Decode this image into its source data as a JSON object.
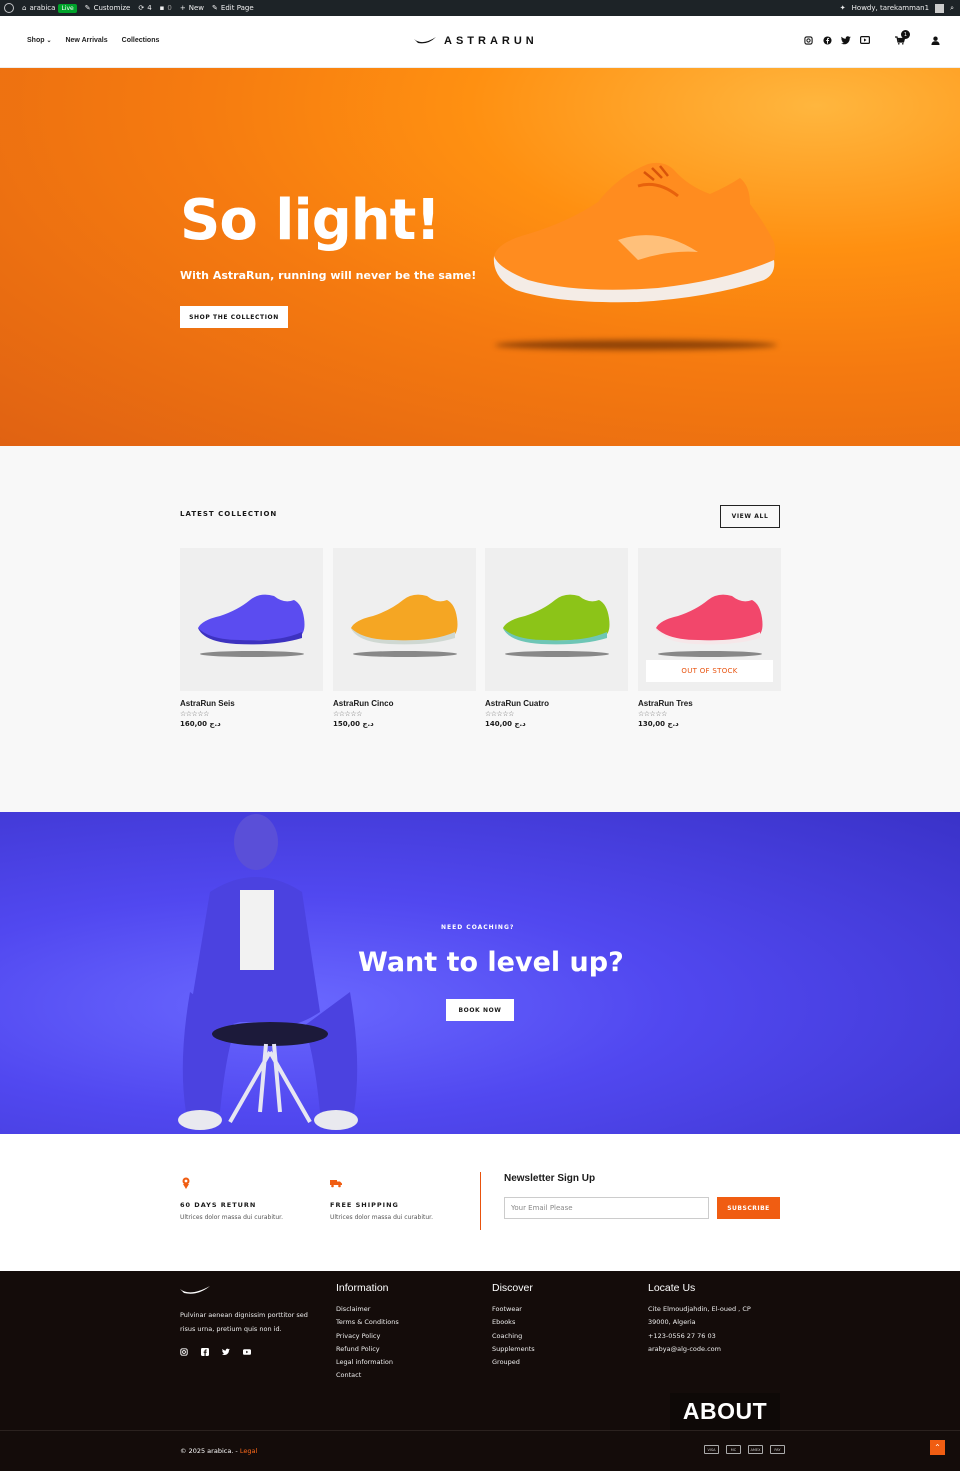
{
  "admin_bar": {
    "site_name": "arabica",
    "live_badge": "Live",
    "customize": "Customize",
    "updates_count": "4",
    "comments_count": "0",
    "new_label": "New",
    "edit_page": "Edit Page",
    "howdy": "Howdy, tarekamman1"
  },
  "header": {
    "nav": [
      "Shop",
      "New Arrivals",
      "Collections"
    ],
    "shop_caret": "⌄",
    "logo_text": "ASTRARUN",
    "cart_count": "1"
  },
  "hero": {
    "title": "So light!",
    "subtitle": "With AstraRun, running will never be the same!",
    "button": "SHOP THE COLLECTION",
    "shoe_color": "#ff8a1f"
  },
  "latest": {
    "title": "LATEST COLLECTION",
    "view_all": "VIEW ALL",
    "products": [
      {
        "name": "AstraRun Seis",
        "stars": "☆☆☆☆☆",
        "price": "160,00 د.ج",
        "color": "#5b4cf0",
        "sole": "#3d32c0"
      },
      {
        "name": "AstraRun Cinco",
        "stars": "☆☆☆☆☆",
        "price": "150,00 د.ج",
        "color": "#f5a623",
        "sole": "#cfd8d2"
      },
      {
        "name": "AstraRun Cuatro",
        "stars": "☆☆☆☆☆",
        "price": "140,00 د.ج",
        "color": "#8cc418",
        "sole": "#6ec6b6"
      },
      {
        "name": "AstraRun Tres",
        "stars": "☆☆☆☆☆",
        "price": "130,00 د.ج",
        "color": "#f2476b",
        "sole": "#f6e7e9",
        "badge": "OUT OF STOCK"
      }
    ]
  },
  "coaching": {
    "kicker": "NEED COACHING?",
    "title": "Want to level up?",
    "button": "BOOK NOW"
  },
  "features": [
    {
      "icon": "return-icon",
      "title": "60 DAYS RETURN",
      "text": "Ultrices dolor massa dui curabitur."
    },
    {
      "icon": "truck-icon",
      "title": "FREE SHIPPING",
      "text": "Ultrices dolor massa dui curabitur."
    }
  ],
  "newsletter": {
    "title": "Newsletter Sign Up",
    "placeholder": "Your Email Please",
    "button": "SUBSCRIBE"
  },
  "footer": {
    "about_text": "Pulvinar aenean dignissim porttitor sed risus urna, pretium quis non id.",
    "information": {
      "title": "Information",
      "links": [
        "Disclaimer",
        "Terms & Conditions",
        "Privacy Policy",
        "Refund Policy",
        "Legal information",
        "Contact"
      ]
    },
    "discover": {
      "title": "Discover",
      "links": [
        "Footwear",
        "Ebooks",
        "Coaching",
        "Supplements",
        "Grouped"
      ]
    },
    "locate": {
      "title": "Locate Us",
      "lines": [
        "Cite Elmoudjahdin, El-oued , CP",
        "39000, Algeria",
        "+123-0556 27 76 03",
        "arabya@alg-code.com"
      ]
    },
    "about_block": "ABOUT",
    "copyright": "© 2025 arabica. -",
    "legal": "Legal",
    "payments": [
      "VISA",
      "MC",
      "AMEX",
      "PAY"
    ]
  },
  "colors": {
    "accent": "#f05d12",
    "footer_bg": "#140c0a",
    "coach_bg": "#5148f0"
  }
}
